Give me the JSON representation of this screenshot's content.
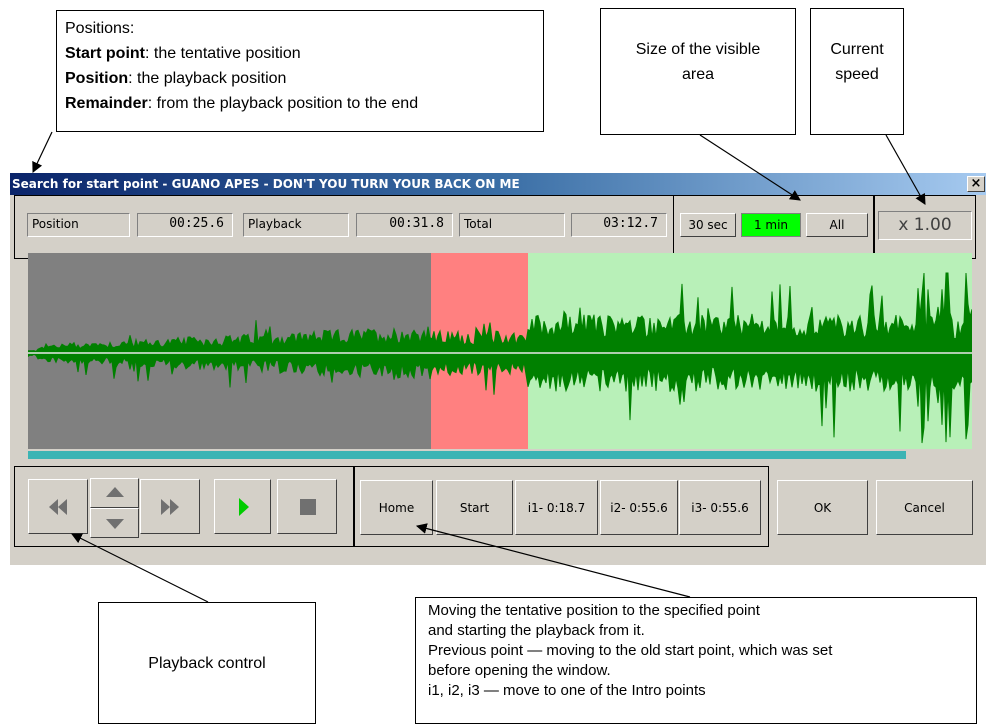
{
  "callouts": {
    "positions": {
      "heading": "Positions:",
      "line1_bold": "Start point",
      "line1_rest": ": the tentative position",
      "line2_bold": "Position",
      "line2_rest": ": the playback position",
      "line3_bold": "Remainder",
      "line3_rest": ": from the playback position to the end"
    },
    "visible_area": "Size of the visible area",
    "current_speed": "Current speed",
    "playback_control": "Playback control",
    "moving": {
      "line1": "Moving the tentative position to the specified point",
      "line2": "and starting the playback from it.",
      "line3": "Previous point — moving to the old start point, which was set",
      "line4": "before opening the window.",
      "line5": "i1, i2, i3 — move to one of the Intro points"
    }
  },
  "window": {
    "title": "Search for start point - GUANO APES - DON'T YOU TURN YOUR BACK ON ME",
    "close": "×"
  },
  "info_bar": {
    "position_label": "Position",
    "position_value": "00:25.6",
    "playback_label": "Playback",
    "playback_value": "00:31.8",
    "total_label": "Total",
    "total_value": "03:12.7"
  },
  "zoom": {
    "options": [
      "30 sec",
      "1 min",
      "All"
    ],
    "selected": "1 min",
    "selected_color": "#00ff00"
  },
  "speed": "x 1.00",
  "waveform": {
    "played_color": "#808080",
    "playback_color": "#ff8080",
    "remaining_color": "#b8f0b8",
    "wave_color": "#008000",
    "progress": 0.93
  },
  "transport": {
    "rewind": "rewind-icon",
    "up": "up-arrow-icon",
    "down": "down-arrow-icon",
    "forward": "fast-forward-icon",
    "play": "play-icon",
    "stop": "stop-icon"
  },
  "points": {
    "home": "Home",
    "start": "Start",
    "i1": "i1- 0:18.7",
    "i2": "i2- 0:55.6",
    "i3": "i3- 0:55.6"
  },
  "dialog": {
    "ok": "OK",
    "cancel": "Cancel"
  }
}
